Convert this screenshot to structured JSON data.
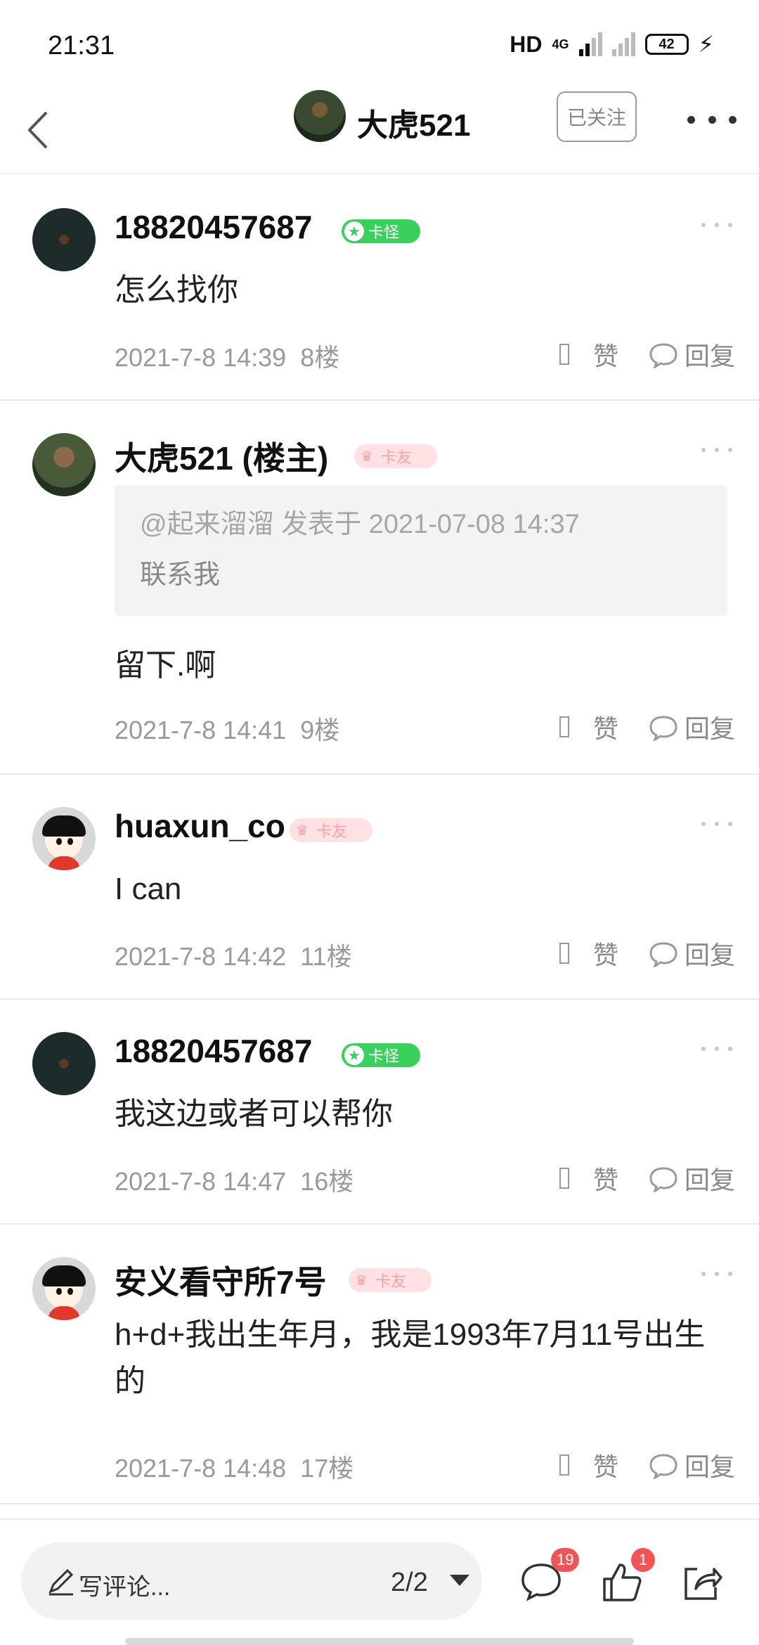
{
  "status_bar": {
    "time": "21:31",
    "hd": "HD",
    "network": "4G",
    "battery": "42"
  },
  "header": {
    "title": "大虎521",
    "follow_label": "已关注"
  },
  "posts": [
    {
      "name": "18820457687",
      "badge": "卡怪",
      "text": "怎么找你",
      "time": "2021-7-8 14:39",
      "floor": "8楼",
      "like_label": "赞",
      "reply_label": "回复"
    },
    {
      "name": "大虎521 (楼主)",
      "badge": "卡友",
      "quote_meta": "@起来溜溜 发表于 2021-07-08 14:37",
      "quote_text": "联系我",
      "text": "留下.啊",
      "time": "2021-7-8 14:41",
      "floor": "9楼",
      "like_label": "赞",
      "reply_label": "回复"
    },
    {
      "name": "huaxun_co",
      "badge": "卡友",
      "text": "I can",
      "time": "2021-7-8 14:42",
      "floor": "11楼",
      "like_label": "赞",
      "reply_label": "回复"
    },
    {
      "name": "18820457687",
      "badge": "卡怪",
      "text": "我这边或者可以帮你",
      "time": "2021-7-8 14:47",
      "floor": "16楼",
      "like_label": "赞",
      "reply_label": "回复"
    },
    {
      "name": "安义看守所7号",
      "badge": "卡友",
      "text": "h+d+我出生年月，我是1993年7月11号出生的",
      "time": "2021-7-8 14:48",
      "floor": "17楼",
      "like_label": "赞",
      "reply_label": "回复"
    }
  ],
  "bottom_bar": {
    "input_placeholder": "写评论...",
    "pager": "2/2",
    "comments_count": "19",
    "likes_count": "1"
  },
  "icons": {
    "back": "chevron-left-icon",
    "more": "more-dots-icon",
    "reply": "speech-bubble-icon",
    "comment": "comment-icon",
    "like": "thumbs-up-icon",
    "share": "share-icon",
    "edit": "pencil-icon"
  },
  "colors": {
    "badge_green": "#39d15c",
    "badge_pink": "#ffe0e3",
    "notify_red": "#f05454"
  }
}
